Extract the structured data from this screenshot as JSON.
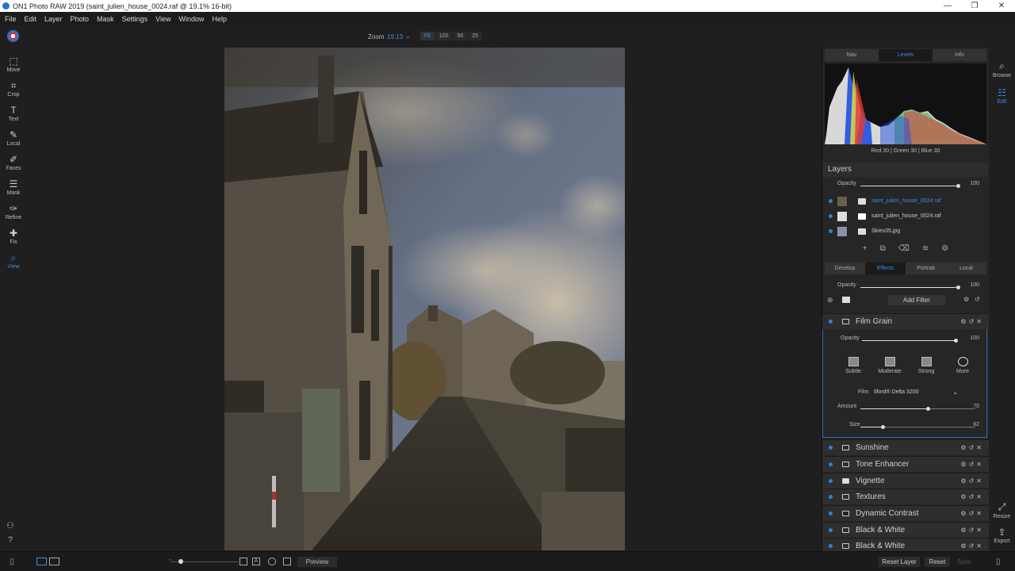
{
  "window": {
    "title": "ON1 Photo RAW 2019 (saint_julien_house_0024.raf @ 19.1% 16-bit)",
    "minimize": "—",
    "maximize": "❐",
    "close": "✕"
  },
  "menu": [
    "File",
    "Edit",
    "Layer",
    "Photo",
    "Mask",
    "Settings",
    "View",
    "Window",
    "Help"
  ],
  "zoom": {
    "label": "Zoom",
    "value": "19.13",
    "caret": "⌄",
    "buttons": [
      "Fit",
      "100",
      "50",
      "25"
    ],
    "active": "Fit"
  },
  "left_tools": [
    {
      "label": "Move",
      "icon": "move-icon",
      "glyph": "⬚"
    },
    {
      "label": "Crop",
      "icon": "crop-icon",
      "glyph": "⌗"
    },
    {
      "label": "Text",
      "icon": "text-icon",
      "glyph": "T"
    },
    {
      "label": "Local",
      "icon": "brush-icon",
      "glyph": "✎"
    },
    {
      "label": "Faces",
      "icon": "faces-icon",
      "glyph": "✐"
    },
    {
      "label": "Mask",
      "icon": "mask-icon",
      "glyph": "☰"
    },
    {
      "label": "Refine",
      "icon": "refine-icon",
      "glyph": "✑"
    },
    {
      "label": "Fix",
      "icon": "fix-icon",
      "glyph": "✚"
    },
    {
      "label": "View",
      "icon": "view-icon",
      "glyph": "⌕"
    }
  ],
  "side_strip": {
    "browse": "Browse",
    "edit": "Edit",
    "resize": "Resize",
    "export": "Export"
  },
  "panel_tabs": [
    "Nav",
    "Levels",
    "Info"
  ],
  "panel_tabs_active": "Levels",
  "histogram_readout": "Red  30  | Green  30  | Blue  30",
  "layers": {
    "title": "Layers",
    "opacity_label": "Opacity",
    "opacity": 100,
    "items": [
      {
        "name": "saint_julien_house_0024.raf",
        "active": true
      },
      {
        "name": "saint_julien_house_0024.raf",
        "active": false
      },
      {
        "name": "Skies35.jpg",
        "active": false
      }
    ]
  },
  "module_tabs": [
    "Develop",
    "Effects",
    "Portrait",
    "Local"
  ],
  "module_tabs_active": "Effects",
  "effects": {
    "opacity_label": "Opacity",
    "opacity": 100,
    "add_filter": "Add Filter",
    "film_grain": {
      "name": "Film Grain",
      "opacity_label": "Opacity",
      "opacity": 100,
      "presets": [
        "Subtle",
        "Moderate",
        "Strong",
        "More"
      ],
      "film_label": "Film",
      "film_value": "Ilford® Delta 3200",
      "amount_label": "Amount",
      "amount": 70,
      "size_label": "Size",
      "size": 82
    },
    "filters": [
      "Sunshine",
      "Tone Enhancer",
      "Vignette",
      "Textures",
      "Dynamic Contrast",
      "Black & White",
      "Black & White"
    ]
  },
  "bottom": {
    "preview": "Preview",
    "reset_layer": "Reset Layer",
    "reset": "Reset",
    "sync": "Sync"
  },
  "colors": {
    "accent": "#3b8ee6",
    "layer_dot": "#2f7fe0"
  }
}
